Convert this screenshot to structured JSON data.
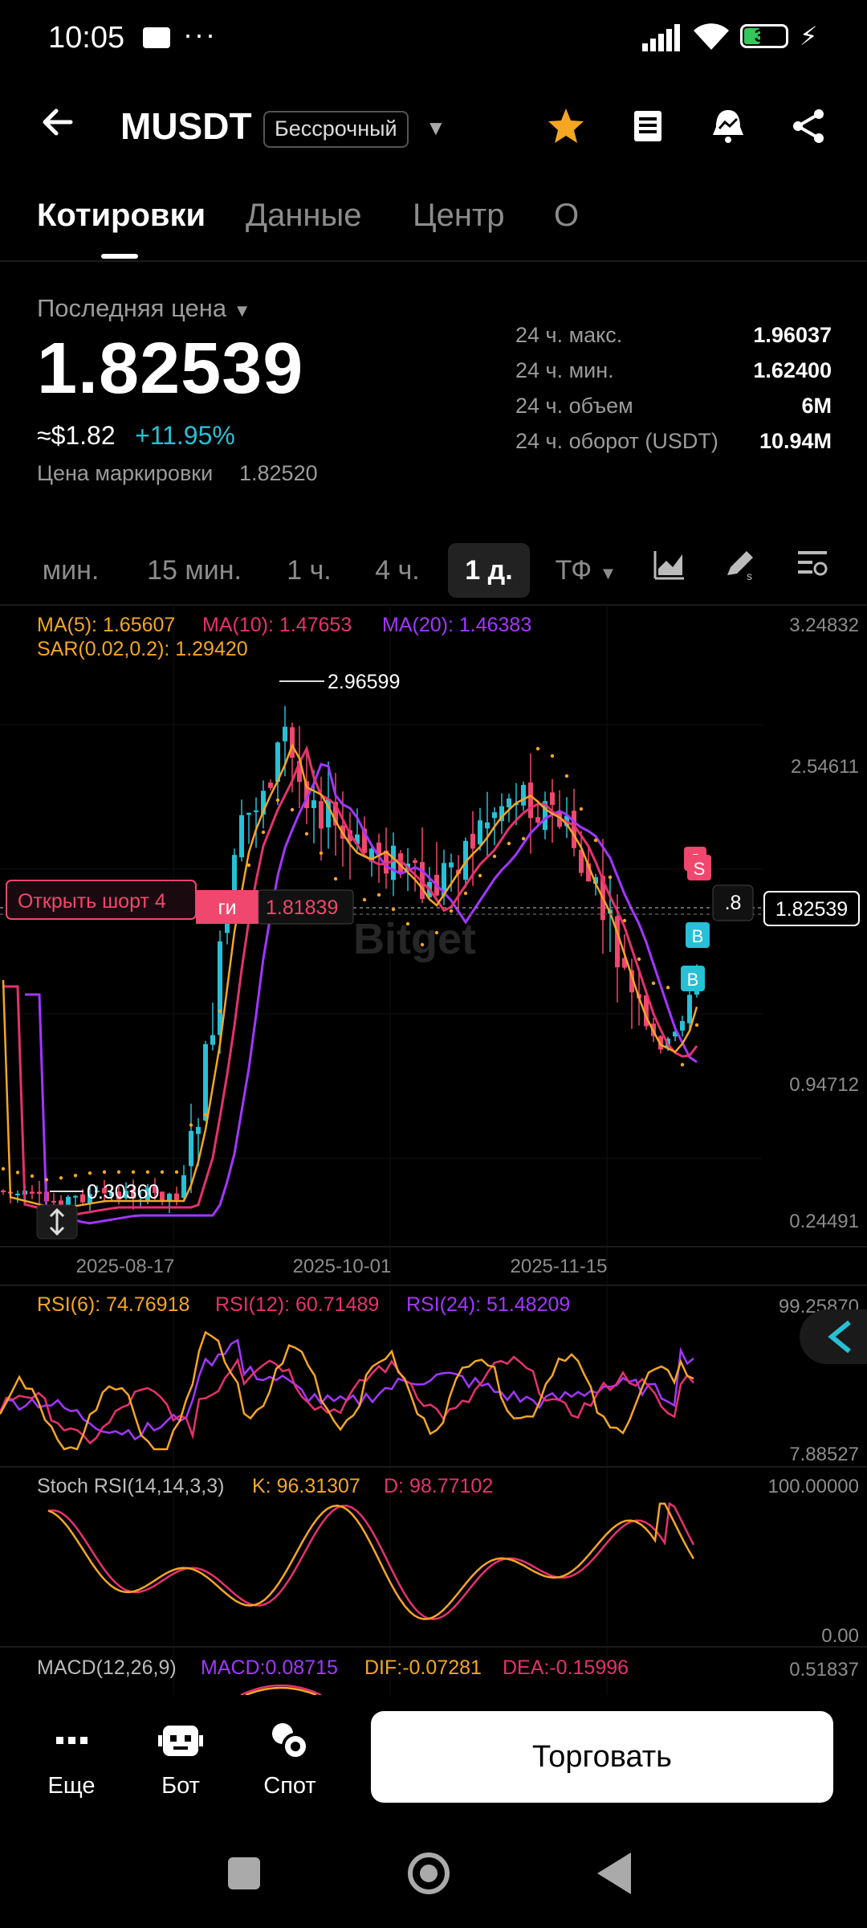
{
  "status_bar": {
    "time": "10:05",
    "dots": "···",
    "battery": "38"
  },
  "header": {
    "title": "MUSDT",
    "badge": "Бессрочный"
  },
  "tabs": [
    {
      "label": "Котировки",
      "active": true
    },
    {
      "label": "Данные"
    },
    {
      "label": "Центр"
    },
    {
      "label": "О"
    }
  ],
  "price": {
    "label": "Последняя цена",
    "last": "1.82539",
    "usd": "≈$1.82",
    "change": "+11.95%",
    "mark_label": "Цена маркировки",
    "mark_value": "1.82520"
  },
  "stats": [
    {
      "label": "24 ч. макс.",
      "value": "1.96037"
    },
    {
      "label": "24 ч. мин.",
      "value": "1.62400"
    },
    {
      "label": "24 ч. объем",
      "value": "6M"
    },
    {
      "label": "24 ч. оборот (USDT)",
      "value": "10.94M"
    }
  ],
  "timeframes": [
    "мин.",
    "15 мин.",
    "1 ч.",
    "4 ч.",
    "1 д.",
    "ТФ"
  ],
  "active_timeframe": "1 д.",
  "chart": {
    "indicators_main": {
      "ma5": "MA(5): 1.65607",
      "ma10": "MA(10): 1.47653",
      "ma20": "MA(20): 1.46383",
      "sar": "SAR(0.02,0.2): 1.29420"
    },
    "price_axis": [
      "3.24832",
      "2.54611",
      "0.94712",
      "0.24491"
    ],
    "high_label": "2.96599",
    "low_label": "0.30360",
    "current_price_tag": "1.82539",
    "position_tag": "Открыть шорт 4",
    "order_tag_type": "ги",
    "order_tag_price": "1.81839",
    "cut_tag": ".8",
    "watermark": "Bitget",
    "dates": [
      "2025-08-17",
      "2025-10-01",
      "2025-11-15"
    ],
    "signals": [
      "S",
      "S",
      "B",
      "B"
    ],
    "rsi": {
      "rsi6": "RSI(6): 74.76918",
      "rsi12": "RSI(12): 60.71489",
      "rsi24": "RSI(24): 51.48209",
      "axis_top": "99.25870",
      "axis_bottom": "7.88527"
    },
    "stoch": {
      "name": "Stoch RSI(14,14,3,3)",
      "k": "K: 96.31307",
      "d": "D: 98.77102",
      "axis_top": "100.00000",
      "axis_bottom": "0.00"
    },
    "macd": {
      "name": "MACD(12,26,9)",
      "macd": "MACD:0.08715",
      "dif": "DIF:-0.07281",
      "dea": "DEA:-0.15996",
      "axis_top": "0.51837"
    },
    "colors": {
      "up": "#27c0d6",
      "down": "#f0476e",
      "ma5": "#f5a623",
      "ma10": "#e6316f",
      "ma20": "#a237ff",
      "sar": "#f5a623"
    }
  },
  "bottom_bar": {
    "more": "Еще",
    "bot": "Бот",
    "spot": "Спот",
    "trade": "Торговать"
  }
}
